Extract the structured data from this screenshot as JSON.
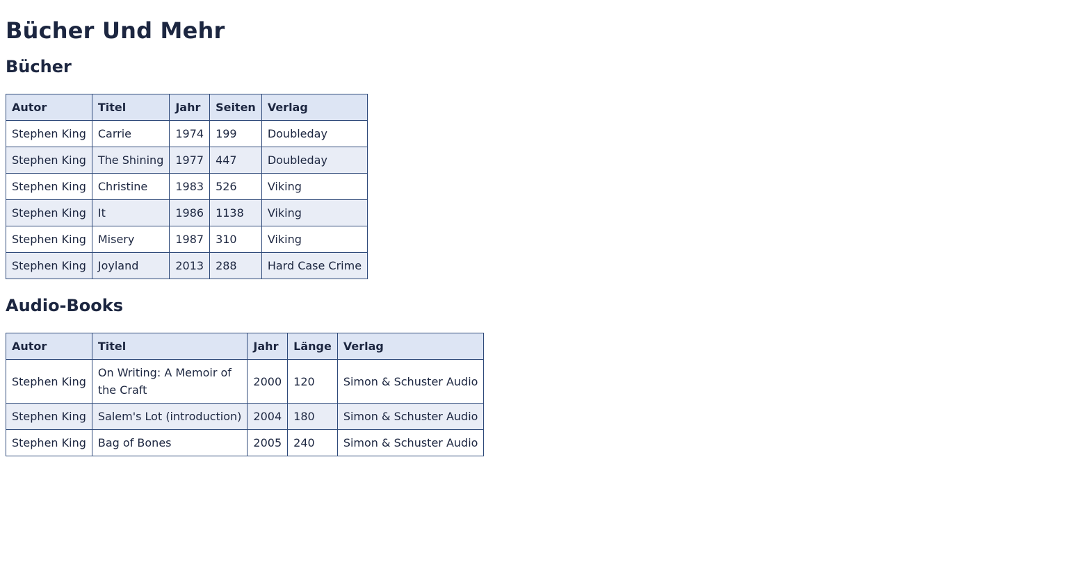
{
  "page_title": "Bücher Und Mehr",
  "books": {
    "heading": "Bücher",
    "columns": [
      "Autor",
      "Titel",
      "Jahr",
      "Seiten",
      "Verlag"
    ],
    "rows": [
      [
        "Stephen King",
        "Carrie",
        "1974",
        "199",
        "Doubleday"
      ],
      [
        "Stephen King",
        "The Shining",
        "1977",
        "447",
        "Doubleday"
      ],
      [
        "Stephen King",
        "Christine",
        "1983",
        "526",
        "Viking"
      ],
      [
        "Stephen King",
        "It",
        "1986",
        "1138",
        "Viking"
      ],
      [
        "Stephen King",
        "Misery",
        "1987",
        "310",
        "Viking"
      ],
      [
        "Stephen King",
        "Joyland",
        "2013",
        "288",
        "Hard Case Crime"
      ]
    ]
  },
  "audiobooks": {
    "heading": "Audio-Books",
    "columns": [
      "Autor",
      "Titel",
      "Jahr",
      "Länge",
      "Verlag"
    ],
    "rows": [
      [
        "Stephen King",
        "On Writing: A Memoir of the Craft",
        "2000",
        "120",
        "Simon & Schuster Audio"
      ],
      [
        "Stephen King",
        "Salem's Lot (introduction)",
        "2004",
        "180",
        "Simon & Schuster Audio"
      ],
      [
        "Stephen King",
        "Bag of Bones",
        "2005",
        "240",
        "Simon & Schuster Audio"
      ]
    ]
  },
  "colors": {
    "text": "#1c2640",
    "border": "#2f4a7a",
    "header_bg": "#dde5f4",
    "stripe_bg": "#e9edf6"
  }
}
